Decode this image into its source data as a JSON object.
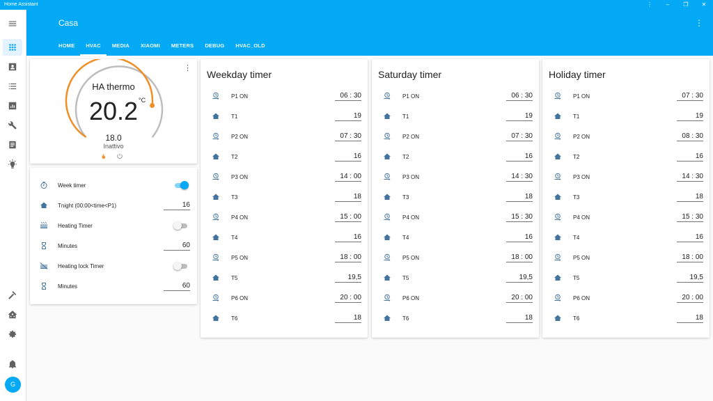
{
  "window": {
    "title": "Home Assistant",
    "btn_more": "⋮",
    "btn_min": "–",
    "btn_max": "❐",
    "btn_close": "✕"
  },
  "header": {
    "title": "Casa",
    "menu": "⋮",
    "tabs": [
      {
        "label": "HOME"
      },
      {
        "label": "HVAC"
      },
      {
        "label": "MEDIA"
      },
      {
        "label": "XIAOMI"
      },
      {
        "label": "METERS"
      },
      {
        "label": "DEBUG"
      },
      {
        "label": "HVAC_OLD"
      }
    ]
  },
  "sidebar": {
    "user_initial": "G"
  },
  "thermostat": {
    "name": "HA thermo",
    "current": "20.2",
    "unit": "°C",
    "target": "18.0",
    "status": "Inattivo",
    "dial_color": "#ef8e25",
    "more": "⋮"
  },
  "entities": [
    {
      "label": "Week timer",
      "type": "toggle",
      "on": true
    },
    {
      "label": "Tnight (00:00<time<P1)",
      "type": "number",
      "value": "16"
    },
    {
      "label": "Heating Timer",
      "type": "toggle",
      "on": false
    },
    {
      "label": "Minutes",
      "type": "number",
      "value": "60"
    },
    {
      "label": "Heating lock Timer",
      "type": "toggle",
      "on": false
    },
    {
      "label": "Minutes",
      "type": "number",
      "value": "60"
    }
  ],
  "timers": [
    {
      "title": "Weekday timer",
      "rows": [
        {
          "label": "P1 ON",
          "value": "06 : 30"
        },
        {
          "label": "T1",
          "value": "19"
        },
        {
          "label": "P2 ON",
          "value": "07 : 30"
        },
        {
          "label": "T2",
          "value": "16"
        },
        {
          "label": "P3 ON",
          "value": "14 : 00"
        },
        {
          "label": "T3",
          "value": "18"
        },
        {
          "label": "P4 ON",
          "value": "15 : 00"
        },
        {
          "label": "T4",
          "value": "16"
        },
        {
          "label": "P5 ON",
          "value": "18 : 00"
        },
        {
          "label": "T5",
          "value": "19,5"
        },
        {
          "label": "P6 ON",
          "value": "20 : 00"
        },
        {
          "label": "T6",
          "value": "18"
        }
      ]
    },
    {
      "title": "Saturday timer",
      "rows": [
        {
          "label": "P1 ON",
          "value": "06 : 30"
        },
        {
          "label": "T1",
          "value": "19"
        },
        {
          "label": "P2 ON",
          "value": "07 : 30"
        },
        {
          "label": "T2",
          "value": "16"
        },
        {
          "label": "P3 ON",
          "value": "14 : 30"
        },
        {
          "label": "T3",
          "value": "18"
        },
        {
          "label": "P4 ON",
          "value": "15 : 30"
        },
        {
          "label": "T4",
          "value": "16"
        },
        {
          "label": "P5 ON",
          "value": "18 : 00"
        },
        {
          "label": "T5",
          "value": "19,5"
        },
        {
          "label": "P6 ON",
          "value": "20 : 00"
        },
        {
          "label": "T6",
          "value": "18"
        }
      ]
    },
    {
      "title": "Holiday timer",
      "rows": [
        {
          "label": "P1 ON",
          "value": "07 : 30"
        },
        {
          "label": "T1",
          "value": "19"
        },
        {
          "label": "P2 ON",
          "value": "08 : 30"
        },
        {
          "label": "T2",
          "value": "16"
        },
        {
          "label": "P3 ON",
          "value": "14 : 30"
        },
        {
          "label": "T3",
          "value": "18"
        },
        {
          "label": "P4 ON",
          "value": "15 : 30"
        },
        {
          "label": "T4",
          "value": "16"
        },
        {
          "label": "P5 ON",
          "value": "18 : 00"
        },
        {
          "label": "T5",
          "value": "19,5"
        },
        {
          "label": "P6 ON",
          "value": "20 : 00"
        },
        {
          "label": "T6",
          "value": "18"
        }
      ]
    }
  ],
  "colors": {
    "accent": "#03a9f4",
    "icon": "#44739e",
    "heat": "#ef8e25"
  }
}
